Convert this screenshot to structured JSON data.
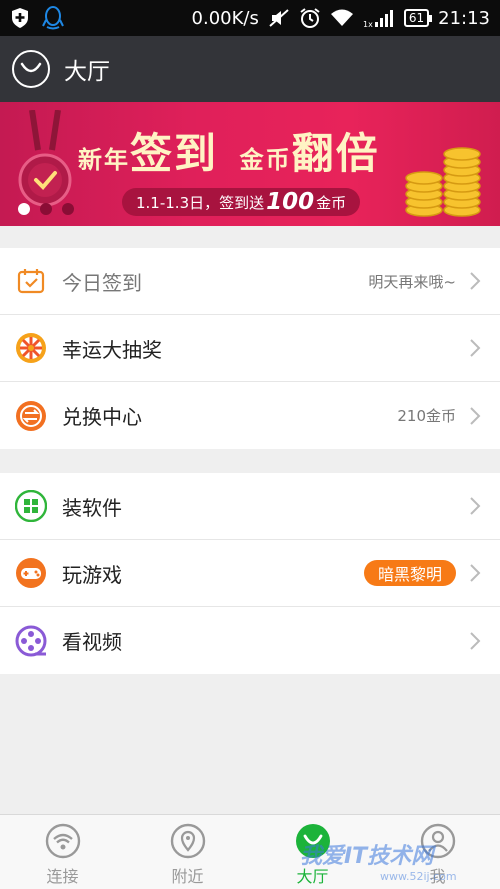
{
  "status_bar": {
    "net_speed": "0.00K/s",
    "battery": "61",
    "time": "21:13",
    "signal_tag": "1x"
  },
  "header": {
    "title": "大厅"
  },
  "banner": {
    "headline_1": "新年",
    "headline_2": "签到",
    "headline_3": "金币",
    "headline_4": "翻倍",
    "subtitle_prefix": "1.1-1.3日，签到送",
    "subtitle_amount": "100",
    "subtitle_suffix": "金币",
    "pager_total": 3,
    "pager_active": 1
  },
  "section_one": [
    {
      "label": "今日签到",
      "meta": "明天再来哦~",
      "icon": "calendar-check-icon",
      "color": "#f08a24"
    },
    {
      "label": "幸运大抽奖",
      "meta": "",
      "icon": "lucky-wheel-icon",
      "color": "#f6a21a"
    },
    {
      "label": "兑换中心",
      "meta": "210金币",
      "icon": "exchange-icon",
      "color": "#f27021"
    }
  ],
  "section_two": [
    {
      "label": "装软件",
      "badge": "",
      "icon": "apps-grid-icon",
      "color": "#2fb53a"
    },
    {
      "label": "玩游戏",
      "badge": "暗黑黎明",
      "icon": "gamepad-icon",
      "color": "#f2731f"
    },
    {
      "label": "看视频",
      "badge": "",
      "icon": "film-reel-icon",
      "color": "#8a5ad6"
    }
  ],
  "tabs": [
    {
      "label": "连接",
      "icon": "wifi-icon"
    },
    {
      "label": "附近",
      "icon": "location-pin-icon"
    },
    {
      "label": "大厅",
      "icon": "hall-icon",
      "active": true
    },
    {
      "label": "我",
      "icon": "user-icon"
    }
  ],
  "watermark": {
    "text": "我爱IT技术网",
    "url": "www.52ij.com"
  },
  "colors": {
    "accent_green": "#1cb33a",
    "banner_red": "#e0205a",
    "title_bar": "#333439",
    "badge_orange": "#f77a16"
  }
}
